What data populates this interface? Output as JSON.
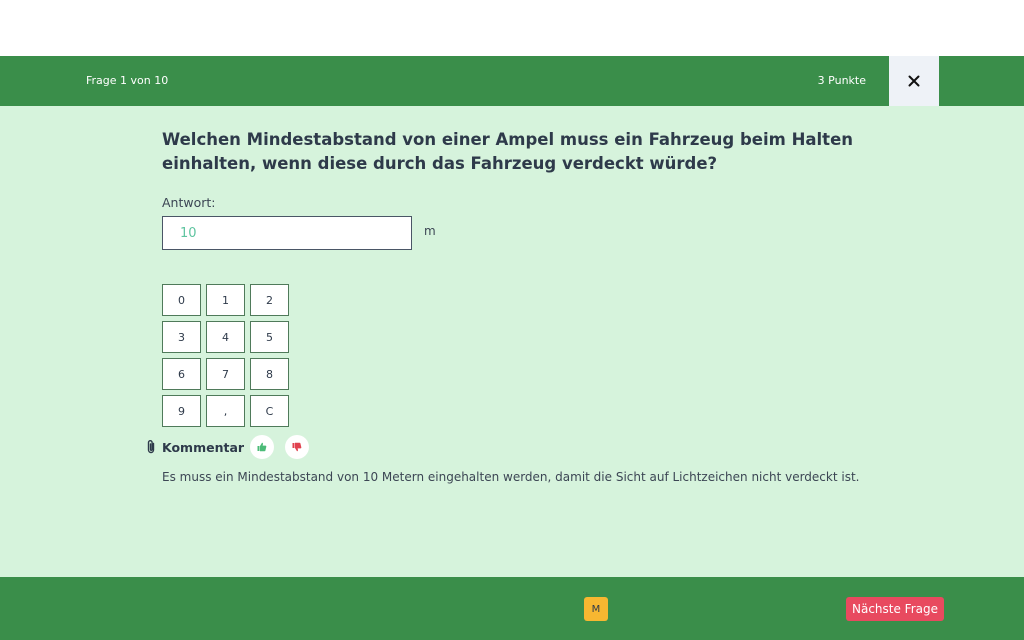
{
  "header": {
    "progress": "Frage 1 von 10",
    "points": "3 Punkte",
    "close_icon": "close-icon"
  },
  "question": {
    "text": "Welchen Mindestabstand von einer Ampel muss ein Fahrzeug beim Halten einhalten, wenn diese durch das Fahrzeug verdeckt würde?",
    "answer_label": "Antwort:",
    "answer_value": "10",
    "unit": "m"
  },
  "keypad": {
    "keys": [
      "0",
      "1",
      "2",
      "3",
      "4",
      "5",
      "6",
      "7",
      "8",
      "9",
      ",",
      "C"
    ]
  },
  "comment": {
    "icon": "paperclip-icon",
    "title": "Kommentar",
    "thumbs_up_icon": "thumbs-up-icon",
    "thumbs_down_icon": "thumbs-down-icon",
    "text": "Es muss ein Mindestabstand von 10 Metern eingehalten werden, damit die Sicht auf Lichtzeichen nicht verdeckt ist."
  },
  "footer": {
    "mark_label": "M",
    "next_label": "Nächste Frage"
  },
  "colors": {
    "bar_green": "#3a8e4a",
    "background_mint": "#d6f3dc",
    "next_button": "#e84a5f",
    "mark_button": "#f7b731",
    "answer_value_text": "#5fc4a0",
    "thumbs_up": "#4cbb78",
    "thumbs_down": "#e0424f"
  }
}
